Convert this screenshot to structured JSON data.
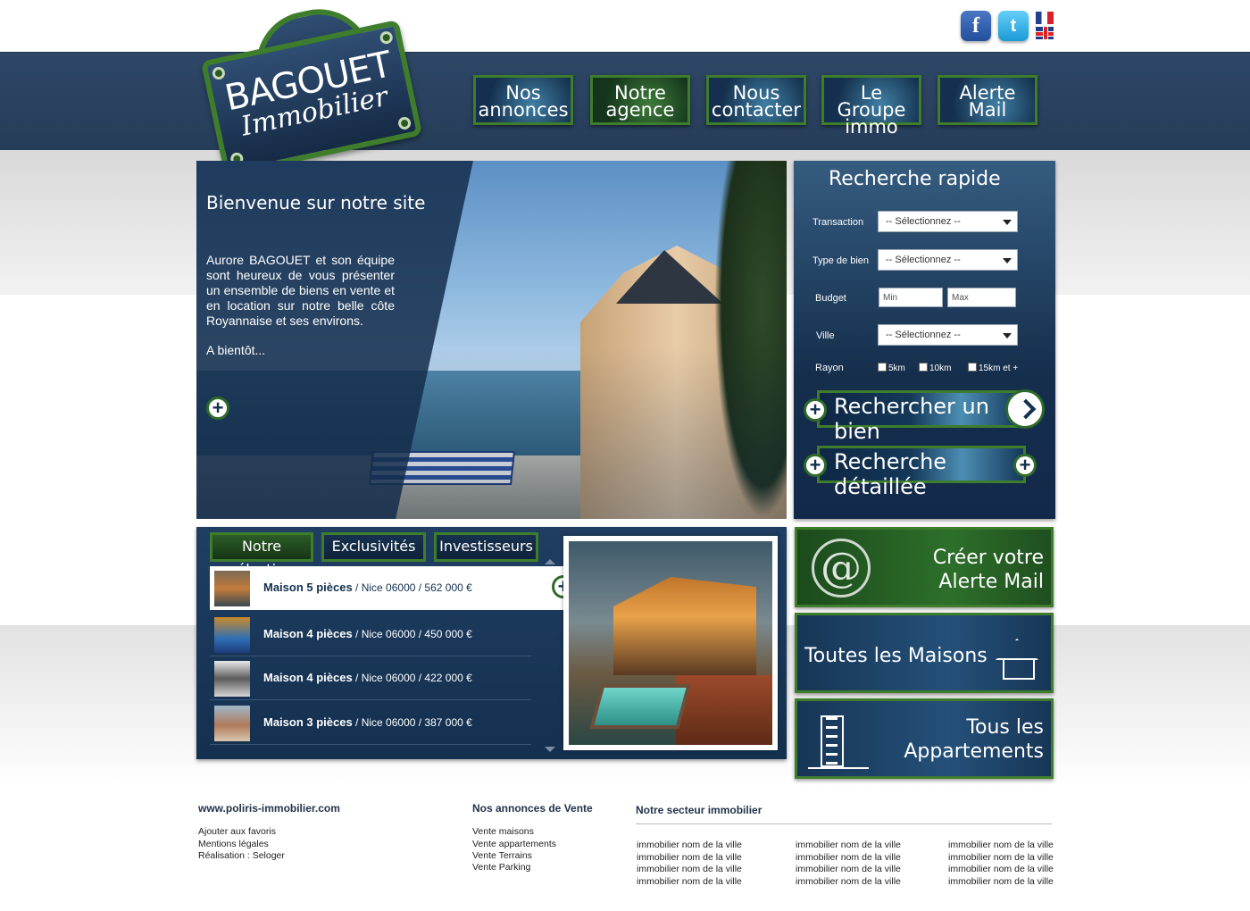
{
  "header": {
    "logo": {
      "line1": "BAGOUET",
      "line2": "Immobilier"
    },
    "social": {
      "facebook": "f",
      "twitter": "t"
    },
    "languages": [
      "fr-flag-icon",
      "uk-flag-icon"
    ],
    "nav": [
      {
        "line1": "Nos",
        "line2": "annonces"
      },
      {
        "line1": "Notre",
        "line2": "agence"
      },
      {
        "line1": "Nous",
        "line2": "contacter"
      },
      {
        "line1": "Le Groupe",
        "line2": "immo"
      },
      {
        "line1": "Alerte",
        "line2": "Mail"
      }
    ]
  },
  "hero": {
    "title": "Bienvenue sur notre site",
    "text": "Aurore BAGOUET et son équipe sont heureux de vous présenter un ensemble de biens en vente et en location sur notre belle côte Royannaise et ses environs.",
    "signoff": "A bientôt..."
  },
  "search": {
    "title": "Recherche rapide",
    "transaction_label": "Transaction",
    "transaction_value": "-- Sélectionnez --",
    "type_label": "Type de bien",
    "type_value": "-- Sélectionnez --",
    "budget_label": "Budget",
    "budget_min": "Min",
    "budget_max": "Max",
    "ville_label": "Ville",
    "ville_value": "-- Sélectionnez --",
    "rayon_label": "Rayon",
    "rayon_options": [
      "5km",
      "10km",
      "15km et +"
    ],
    "btn_search": "Rechercher un bien",
    "btn_detailed": "Recherche détaillée"
  },
  "selection": {
    "tabs": [
      "Notre sélection",
      "Exclusivités",
      "Investisseurs"
    ],
    "items": [
      {
        "title": "Maison 5 pièces",
        "details": " / Nice 06000 / 562 000 €"
      },
      {
        "title": "Maison 4 pièces",
        "details": " / Nice 06000 / 450 000 €"
      },
      {
        "title": "Maison 4 pièces",
        "details": " / Nice 06000 / 422 000 €"
      },
      {
        "title": "Maison 3 pièces",
        "details": " / Nice 06000 / 387 000 €"
      }
    ]
  },
  "promos": {
    "mail": {
      "line1": "Créer votre",
      "line2": "Alerte Mail"
    },
    "houses": {
      "line1": "Toutes les Maisons"
    },
    "apartments": {
      "line1": "Tous les",
      "line2": "Appartements"
    }
  },
  "footer": {
    "site": "www.poliris-immobilier.com",
    "links": [
      "Ajouter aux favoris",
      "Mentions légales",
      "Réalisation : Seloger"
    ],
    "sales_title": "Nos annonces de Vente",
    "sales_links": [
      "Vente maisons",
      "Vente appartements",
      "Vente Terrains",
      "Vente Parking"
    ],
    "sector_title": "Notre secteur immobilier",
    "sector_col1": [
      "immobilier nom de la ville",
      "immobilier nom de la ville",
      "immobilier nom de la ville",
      "immobilier nom de la ville"
    ],
    "sector_col2": [
      "immobilier nom de la ville",
      "immobilier nom de la ville",
      "immobilier nom de la ville",
      "immobilier nom de la ville"
    ],
    "sector_col3": [
      "immobilier nom de la ville",
      "immobilier nom de la ville",
      "immobilier nom de la ville",
      "immobilier nom de la ville"
    ]
  },
  "colors": {
    "navy": "#1f3e62",
    "green_border": "#3d7d2c"
  }
}
